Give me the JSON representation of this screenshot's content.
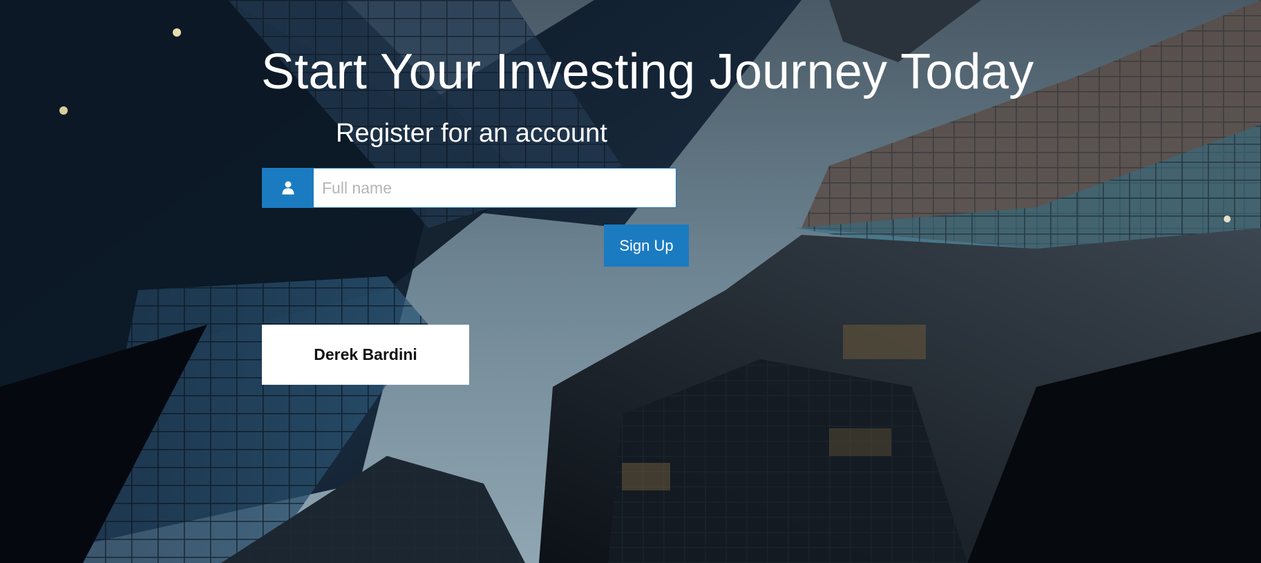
{
  "hero": {
    "title": "Start Your Investing Journey Today",
    "subtitle": "Register for an account"
  },
  "form": {
    "name_icon": "user-icon",
    "name_value": "",
    "name_placeholder": "Full name",
    "submit_label": "Sign Up"
  },
  "result": {
    "name": "Derek Bardini"
  },
  "colors": {
    "accent": "#1b7bc1",
    "text_on_dark": "#ffffff",
    "card_bg": "#ffffff"
  },
  "background": {
    "description_icon": "city-skyscrapers-photo"
  }
}
